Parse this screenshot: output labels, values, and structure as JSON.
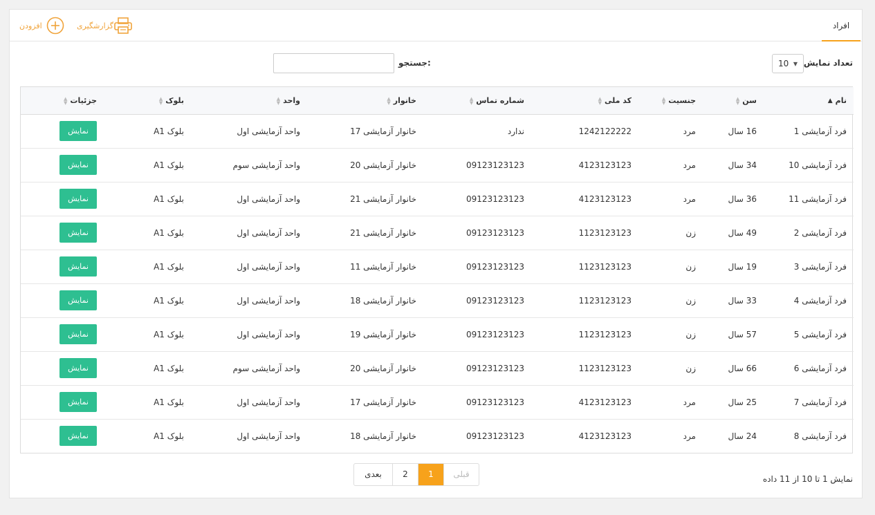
{
  "header": {
    "title": "افراد",
    "report_label": "گزارشگیری",
    "add_label": "افزودن"
  },
  "controls": {
    "length_label": "تعداد نمایش",
    "length_value": "10",
    "search_label": "جستجو:",
    "search_value": ""
  },
  "table": {
    "columns": [
      "نام",
      "سن",
      "جنسیت",
      "کد ملی",
      "شماره تماس",
      "خانوار",
      "واحد",
      "بلوک",
      "جزئیات"
    ],
    "rows": [
      [
        "فرد آزمایشی 1",
        "16 سال",
        "مرد",
        "1242122222",
        "ندارد",
        "خانوار آزمایشی 17",
        "واحد آزمایشی اول",
        "بلوک A1",
        "نمایش"
      ],
      [
        "فرد آزمایشی 10",
        "34 سال",
        "مرد",
        "4123123123",
        "09123123123",
        "خانوار آزمایشی 20",
        "واحد آزمایشی سوم",
        "بلوک A1",
        "نمایش"
      ],
      [
        "فرد آزمایشی 11",
        "36 سال",
        "مرد",
        "4123123123",
        "09123123123",
        "خانوار آزمایشی 21",
        "واحد آزمایشی اول",
        "بلوک A1",
        "نمایش"
      ],
      [
        "فرد آزمایشی 2",
        "49 سال",
        "زن",
        "1123123123",
        "09123123123",
        "خانوار آزمایشی 21",
        "واحد آزمایشی اول",
        "بلوک A1",
        "نمایش"
      ],
      [
        "فرد آزمایشی 3",
        "19 سال",
        "زن",
        "1123123123",
        "09123123123",
        "خانوار آزمایشی 11",
        "واحد آزمایشی اول",
        "بلوک A1",
        "نمایش"
      ],
      [
        "فرد آزمایشی 4",
        "33 سال",
        "زن",
        "1123123123",
        "09123123123",
        "خانوار آزمایشی 18",
        "واحد آزمایشی اول",
        "بلوک A1",
        "نمایش"
      ],
      [
        "فرد آزمایشی 5",
        "57 سال",
        "زن",
        "1123123123",
        "09123123123",
        "خانوار آزمایشی 19",
        "واحد آزمایشی اول",
        "بلوک A1",
        "نمایش"
      ],
      [
        "فرد آزمایشی 6",
        "66 سال",
        "زن",
        "1123123123",
        "09123123123",
        "خانوار آزمایشی 20",
        "واحد آزمایشی سوم",
        "بلوک A1",
        "نمایش"
      ],
      [
        "فرد آزمایشی 7",
        "25 سال",
        "مرد",
        "4123123123",
        "09123123123",
        "خانوار آزمایشی 17",
        "واحد آزمایشی اول",
        "بلوک A1",
        "نمایش"
      ],
      [
        "فرد آزمایشی 8",
        "24 سال",
        "مرد",
        "4123123123",
        "09123123123",
        "خانوار آزمایشی 18",
        "واحد آزمایشی اول",
        "بلوک A1",
        "نمایش"
      ]
    ]
  },
  "footer": {
    "info": "نمایش 1 تا 10 از 11 داده",
    "pagination": {
      "prev": "قبلی",
      "pages": [
        "1",
        "2"
      ],
      "next": "بعدی",
      "active": "1"
    }
  },
  "colors": {
    "accent": "#f7a21b",
    "action": "#f0a33a",
    "button": "#2ebf91"
  },
  "icons": [
    "printer-icon",
    "plus-circle-icon",
    "sort-icon",
    "sort-asc-icon",
    "caret-down-icon"
  ]
}
